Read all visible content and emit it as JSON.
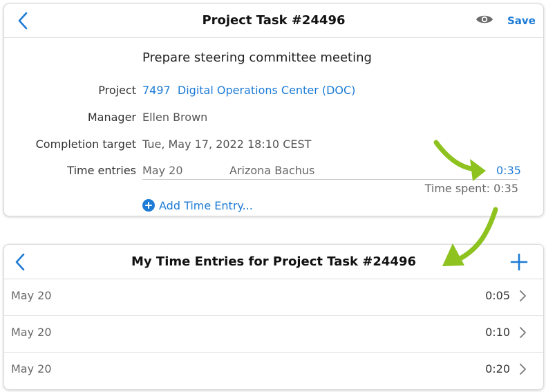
{
  "colors": {
    "accent": "#1c7bd6",
    "arrow": "#8dc21f"
  },
  "top_screen": {
    "header": {
      "title": "Project Task #24496",
      "back_icon": "chevron-left-icon",
      "view_icon": "eye-icon",
      "save_label": "Save"
    },
    "task_title": "Prepare steering committee meeting",
    "fields": {
      "project_label": "Project",
      "project_value": "7497  Digital Operations Center (DOC)",
      "manager_label": "Manager",
      "manager_value": "Ellen Brown",
      "target_label": "Completion target",
      "target_value": "Tue, May 17, 2022 18:10 CEST",
      "entries_label": "Time entries"
    },
    "time_entry": {
      "date": "May 20",
      "person": "Arizona Bachus",
      "duration": "0:35"
    },
    "time_spent": "Time spent: 0:35",
    "add_entry_label": "Add Time Entry..."
  },
  "bottom_screen": {
    "header": {
      "title": "My Time Entries for Project Task #24496",
      "back_icon": "chevron-left-icon",
      "add_icon": "plus-icon"
    },
    "entries": [
      {
        "date": "May 20",
        "duration": "0:05"
      },
      {
        "date": "May 20",
        "duration": "0:10"
      },
      {
        "date": "May 20",
        "duration": "0:20"
      }
    ]
  }
}
